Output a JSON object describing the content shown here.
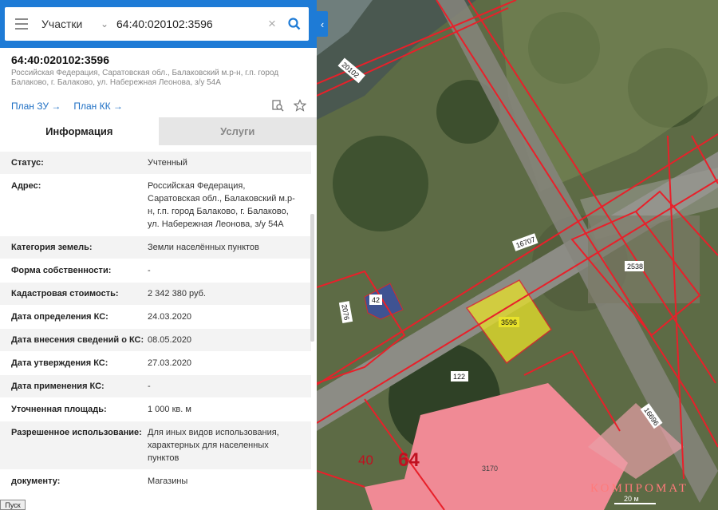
{
  "search": {
    "category": "Участки",
    "query": "64:40:020102:3596"
  },
  "parcel": {
    "title": "64:40:020102:3596",
    "address_line1": "Российская Федерация, Саратовская обл., Балаковский м.р-н, г.п. город",
    "address_line2": "Балаково, г. Балаково, ул. Набережная Леонова, з/у 54А"
  },
  "links": {
    "plan_zu": "План ЗУ",
    "plan_kk": "План КК"
  },
  "tabs": [
    {
      "label": "Информация"
    },
    {
      "label": "Услуги"
    }
  ],
  "rows": [
    {
      "key": "Статус:",
      "value": "Учтенный"
    },
    {
      "key": "Адрес:",
      "value": "Российская Федерация, Саратовская обл., Балаковский м.р-н, г.п. город Балаково, г. Балаково, ул. Набережная Леонова, з/у 54А"
    },
    {
      "key": "Категория земель:",
      "value": "Земли населённых пунктов"
    },
    {
      "key": "Форма собственности:",
      "value": "-"
    },
    {
      "key": "Кадастровая стоимость:",
      "value": "2 342 380 руб."
    },
    {
      "key": "Дата определения КС:",
      "value": "24.03.2020"
    },
    {
      "key": "Дата внесения сведений о КС:",
      "value": "08.05.2020"
    },
    {
      "key": "Дата утверждения КС:",
      "value": "27.03.2020"
    },
    {
      "key": "Дата применения КС:",
      "value": "-"
    },
    {
      "key": "Уточненная площадь:",
      "value": "1 000 кв. м"
    },
    {
      "key": "Разрешенное использование:",
      "value": "Для иных видов использования, характерных для населенных пунктов"
    },
    {
      "key": "документу:",
      "value": "Магазины"
    }
  ],
  "map": {
    "labels": {
      "l20102": "20102",
      "l16707": "16707",
      "l2538": "2538",
      "l42": "42",
      "l2076": "2076",
      "l3596": "3596",
      "l122": "122",
      "l40": "40",
      "l64": "64",
      "l16696": "16696",
      "l3170": "3170"
    },
    "scale": "20 м",
    "watermark": "КОМПРОМАТ"
  },
  "taskbar": {
    "start": "Пуск"
  },
  "colors": {
    "accent": "#1e7bd6",
    "boundary": "#e8202a",
    "selected_parcel": "#e8e22a",
    "buildings": "#f08a95"
  }
}
